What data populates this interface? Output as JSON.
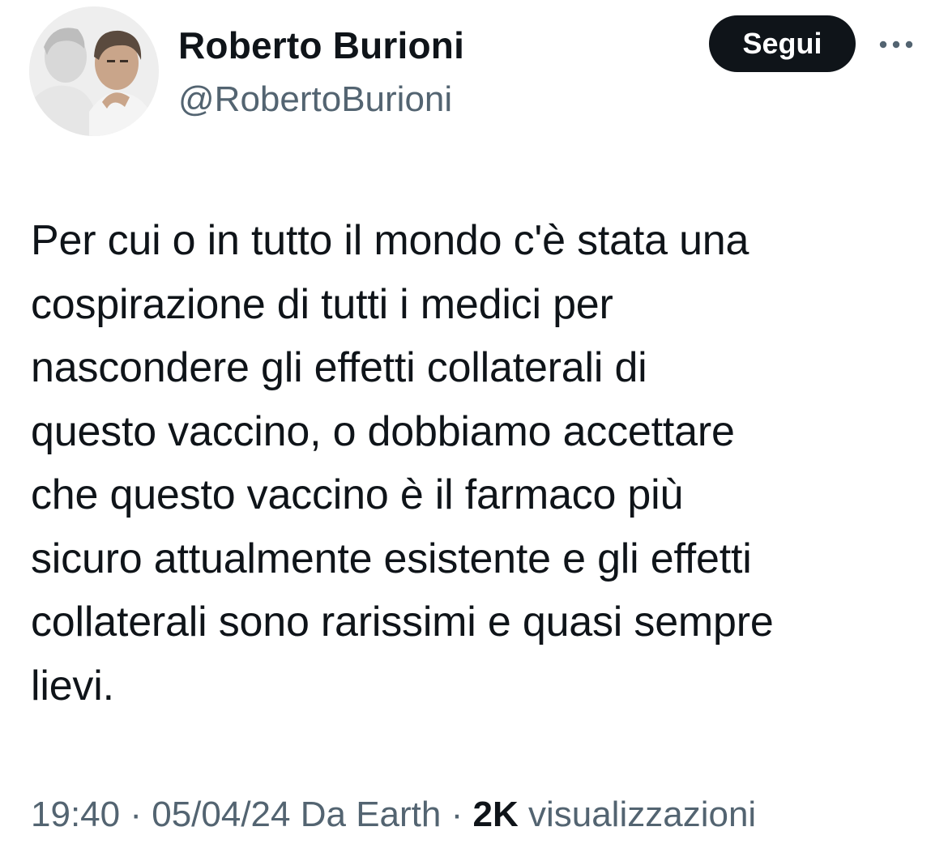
{
  "author": {
    "display_name": "Roberto Burioni",
    "handle": "@RobertoBurioni"
  },
  "actions": {
    "follow_label": "Segui",
    "more_icon": "more-horizontal-icon"
  },
  "tweet": {
    "text": "Per cui o in tutto il mondo c'è stata una\ncospirazione di tutti i medici per\nnascondere gli effetti collaterali di\nquesto vaccino, o dobbiamo accettare\nche questo vaccino è il farmaco più\nsicuro attualmente esistente e gli effetti\ncollaterali sono rarissimi e quasi sempre\nlievi."
  },
  "meta": {
    "time": "19:40",
    "separator_1": " · ",
    "date": "05/04/24",
    "source": " Da Earth",
    "separator_2": " · ",
    "views_count": "2K",
    "views_label": " visualizzazioni"
  },
  "colors": {
    "text_primary": "#0f1419",
    "text_secondary": "#536471",
    "button_bg": "#0f1419",
    "button_text": "#ffffff"
  }
}
